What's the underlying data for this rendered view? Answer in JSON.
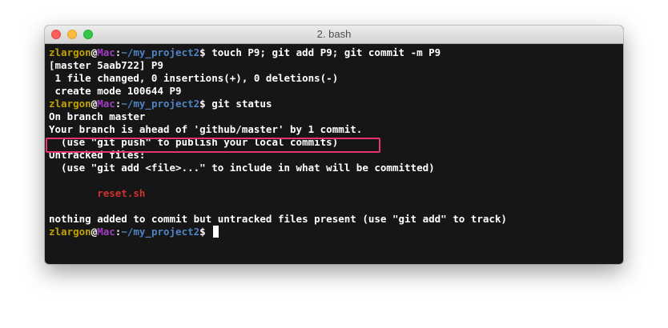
{
  "window": {
    "title": "2. bash"
  },
  "prompt": {
    "user": "zlargon",
    "at": "@",
    "host": "Mac",
    "colon": ":",
    "path": "~/my_project2",
    "symbol": "$ "
  },
  "terminal": {
    "lines": [
      {
        "type": "prompt",
        "command": "touch P9; git add P9; git commit -m P9"
      },
      {
        "type": "text",
        "text": "[master 5aab722] P9"
      },
      {
        "type": "text",
        "text": " 1 file changed, 0 insertions(+), 0 deletions(-)"
      },
      {
        "type": "text",
        "text": " create mode 100644 P9"
      },
      {
        "type": "prompt",
        "command": "git status"
      },
      {
        "type": "text",
        "text": "On branch master"
      },
      {
        "type": "text",
        "text": "Your branch is ahead of 'github/master' by 1 commit."
      },
      {
        "type": "text",
        "text": "  (use \"git push\" to publish your local commits)"
      },
      {
        "type": "text",
        "text": "Untracked files:"
      },
      {
        "type": "text",
        "text": "  (use \"git add <file>...\" to include in what will be committed)"
      },
      {
        "type": "text",
        "text": ""
      },
      {
        "type": "text",
        "text": "        reset.sh"
      },
      {
        "type": "text",
        "text": ""
      },
      {
        "type": "text",
        "text": "nothing added to commit but untracked files present (use \"git add\" to track)"
      },
      {
        "type": "prompt",
        "command": ""
      }
    ]
  },
  "colors": {
    "user": "#c4a000",
    "host": "#a03fc0",
    "path": "#4f84c4",
    "untracked_file": "#d22f2f",
    "highlight_border": "#e8336b"
  }
}
